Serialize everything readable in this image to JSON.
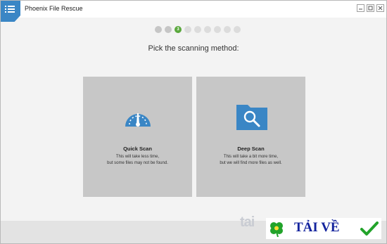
{
  "window": {
    "title": "Phoenix File Rescue"
  },
  "steps": {
    "current_label": "3",
    "total": 9,
    "current_index": 2
  },
  "prompt": "Pick the scanning method:",
  "options": [
    {
      "title": "Quick Scan",
      "desc_line1": "This will take less time,",
      "desc_line2": "but some files may not be found.",
      "icon": "speedometer-icon"
    },
    {
      "title": "Deep Scan",
      "desc_line1": "This will take a bit more time,",
      "desc_line2": "but we will find more files as well.",
      "icon": "folder-search-icon"
    }
  ],
  "watermark": {
    "brand_left": "tai",
    "brand_right": "TẢI VỀ"
  },
  "colors": {
    "accent_blue": "#3a86c5",
    "step_green": "#5aa83d",
    "card_gray": "#c7c7c7"
  }
}
